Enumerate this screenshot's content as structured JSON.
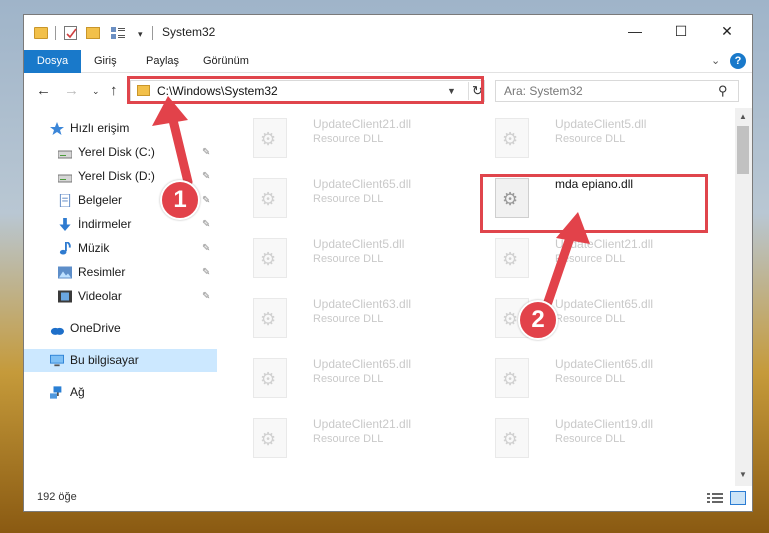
{
  "window": {
    "title": "System32",
    "controls": {
      "minimize": "—",
      "maximize": "☐",
      "close": "✕"
    }
  },
  "ribbon": {
    "tabs": [
      "Dosya",
      "Giriş",
      "Paylaş",
      "Görünüm"
    ],
    "expand": "⌄",
    "help": "?"
  },
  "nav": {
    "back": "←",
    "forward": "→",
    "recent": "⌄",
    "up": "↑",
    "address": "C:\\Windows\\System32",
    "refresh": "↻",
    "search_placeholder": "Ara: System32"
  },
  "sidebar": {
    "items": [
      {
        "label": "Hızlı erişim",
        "icon": "star-icon",
        "pinned": false
      },
      {
        "label": "Yerel Disk (C:)",
        "icon": "drive-icon",
        "pinned": true
      },
      {
        "label": "Yerel Disk (D:)",
        "icon": "drive-icon",
        "pinned": true
      },
      {
        "label": "Belgeler",
        "icon": "documents-icon",
        "pinned": true
      },
      {
        "label": "İndirmeler",
        "icon": "download-icon",
        "pinned": true
      },
      {
        "label": "Müzik",
        "icon": "music-icon",
        "pinned": true
      },
      {
        "label": "Resimler",
        "icon": "pictures-icon",
        "pinned": true
      },
      {
        "label": "Videolar",
        "icon": "videos-icon",
        "pinned": true
      },
      {
        "label": "OneDrive",
        "icon": "cloud-icon",
        "pinned": false
      },
      {
        "label": "Bu bilgisayar",
        "icon": "computer-icon",
        "pinned": false
      },
      {
        "label": "Ağ",
        "icon": "network-icon",
        "pinned": false
      }
    ],
    "pin_glyph": "📌"
  },
  "files": [
    {
      "name": "UpdateClient21.dll",
      "desc": "Resource DLL"
    },
    {
      "name": "UpdateClient5.dll",
      "desc": "Resource DLL"
    },
    {
      "name": "UpdateClient65.dll",
      "desc": "Resource DLL"
    },
    {
      "name": "mda epiano.dll",
      "desc": ""
    },
    {
      "name": "UpdateClient5.dll",
      "desc": "Resource DLL"
    },
    {
      "name": "UpdateClient21.dll",
      "desc": "Resource DLL"
    },
    {
      "name": "UpdateClient63.dll",
      "desc": "Resource DLL"
    },
    {
      "name": "UpdateClient65.dll",
      "desc": "Resource DLL"
    },
    {
      "name": "UpdateClient65.dll",
      "desc": "Resource DLL"
    },
    {
      "name": "UpdateClient65.dll",
      "desc": "Resource DLL"
    },
    {
      "name": "UpdateClient21.dll",
      "desc": "Resource DLL"
    },
    {
      "name": "UpdateClient19.dll",
      "desc": "Resource DLL"
    }
  ],
  "status": {
    "count": "192 öğe"
  },
  "annotations": {
    "step1": "1",
    "step2": "2",
    "color": "#e0454c"
  }
}
